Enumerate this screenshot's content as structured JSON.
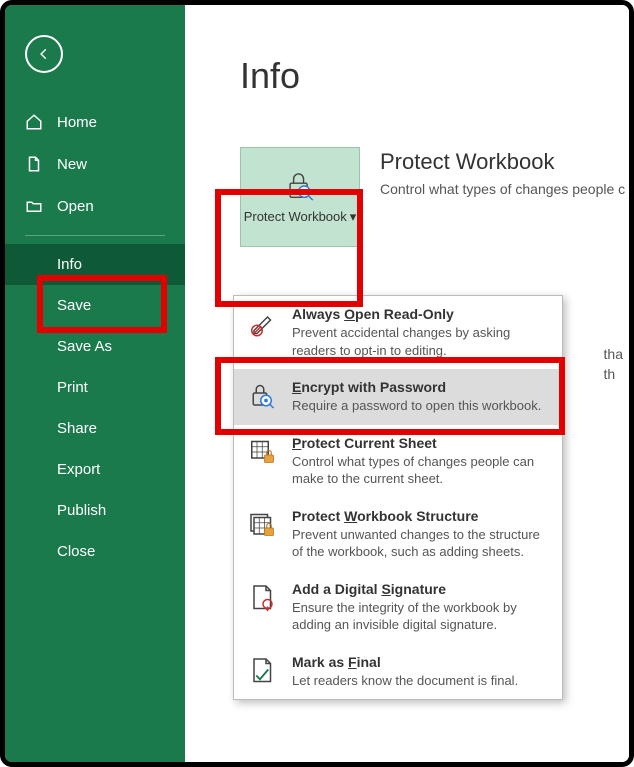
{
  "sidebar": {
    "items": [
      {
        "label": "Home",
        "icon": "home-icon"
      },
      {
        "label": "New",
        "icon": "new-icon"
      },
      {
        "label": "Open",
        "icon": "open-icon"
      },
      {
        "label": "Info",
        "icon": null,
        "active": true
      },
      {
        "label": "Save",
        "icon": null
      },
      {
        "label": "Save As",
        "icon": null
      },
      {
        "label": "Print",
        "icon": null
      },
      {
        "label": "Share",
        "icon": null
      },
      {
        "label": "Export",
        "icon": null
      },
      {
        "label": "Publish",
        "icon": null
      },
      {
        "label": "Close",
        "icon": null
      }
    ]
  },
  "main": {
    "title": "Info",
    "protect_button_label": "Protect Workbook",
    "section_heading": "Protect Workbook",
    "section_sub": "Control what types of changes people c",
    "side_note_1": "tha",
    "side_note_2": "th"
  },
  "dropdown": {
    "items": [
      {
        "title_pre": "Always ",
        "title_u": "O",
        "title_post": "pen Read-Only",
        "desc": "Prevent accidental changes by asking readers to opt-in to editing."
      },
      {
        "title_pre": "",
        "title_u": "E",
        "title_post": "ncrypt with Password",
        "desc": "Require a password to open this workbook."
      },
      {
        "title_pre": "",
        "title_u": "P",
        "title_post": "rotect Current Sheet",
        "desc": "Control what types of changes people can make to the current sheet."
      },
      {
        "title_pre": "Protect ",
        "title_u": "W",
        "title_post": "orkbook Structure",
        "desc": "Prevent unwanted changes to the structure of the workbook, such as adding sheets."
      },
      {
        "title_pre": "Add a Digital ",
        "title_u": "S",
        "title_post": "ignature",
        "desc": "Ensure the integrity of the workbook by adding an invisible digital signature."
      },
      {
        "title_pre": "Mark as ",
        "title_u": "F",
        "title_post": "inal",
        "desc": "Let readers know the document is final."
      }
    ]
  }
}
